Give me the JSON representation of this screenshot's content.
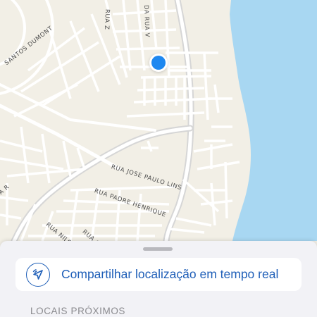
{
  "map": {
    "street_labels": [
      "SANTOS DUMONT",
      "RUA Z",
      "DA RUA V",
      "RUA JOSE PAULO LINS",
      "RUA PADRE HENRIQUE",
      "RUA NILO",
      "RUA OLI",
      "A R"
    ],
    "colors": {
      "land": "#f2efe6",
      "road": "#ffffff",
      "major_road": "#d8d8d8",
      "water": "#a8d7f2",
      "location_dot": "#1e88f0"
    }
  },
  "sheet": {
    "share_button": {
      "label": "Compartilhar localização em tempo real",
      "icon": "location-share-icon"
    },
    "section_header": "LOCAIS PRÓXIMOS"
  }
}
